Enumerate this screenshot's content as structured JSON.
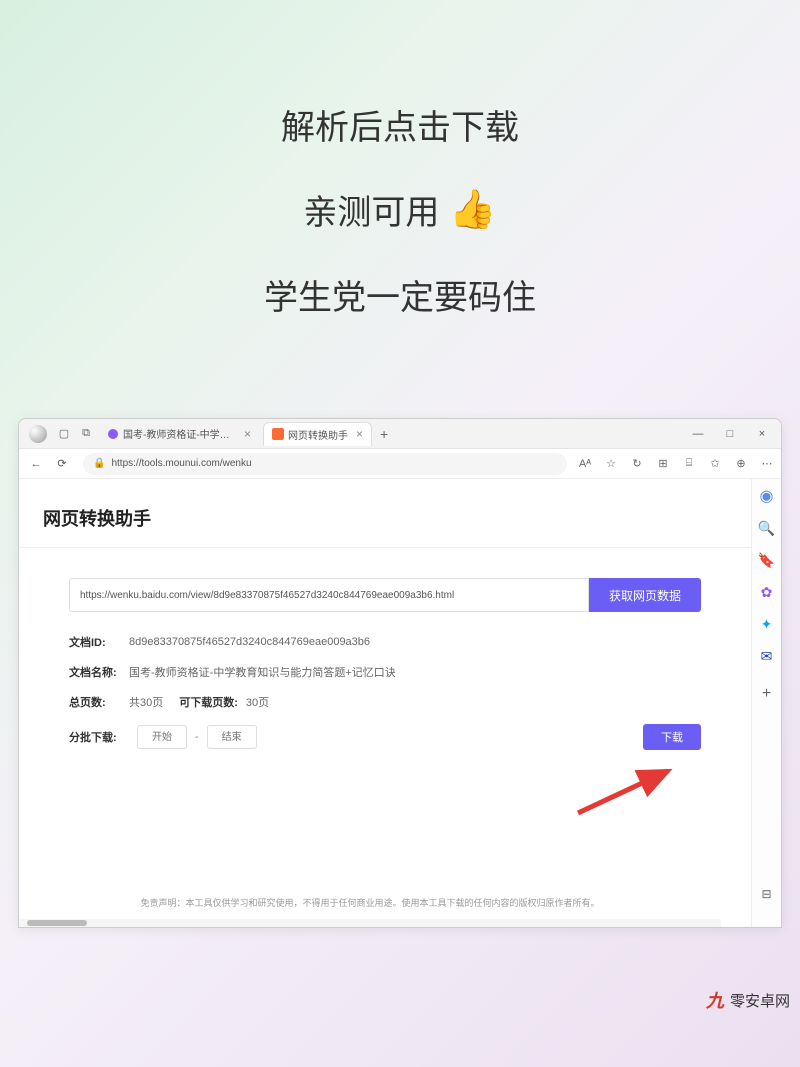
{
  "promo": {
    "line1": "解析后点击下载",
    "line2": "亲测可用",
    "line3": "学生党一定要码住"
  },
  "browser": {
    "tabs": [
      {
        "title": "国考-教师资格证-中学教育知识"
      },
      {
        "title": "网页转换助手"
      }
    ],
    "new_tab": "+",
    "window_controls": {
      "min": "—",
      "max": "□",
      "close": "×"
    },
    "nav": {
      "back": "←",
      "refresh": "⟳"
    },
    "url": "https://tools.mounui.com/wenku",
    "addr_tools": {
      "aa": "Aᴬ",
      "star": "☆",
      "refresh2": "↻",
      "puzzle": "⊞",
      "collections": "⌸",
      "favorites": "✩",
      "settings": "⊕",
      "more": "⋯"
    }
  },
  "sidebar_icons": [
    "◐",
    "🔍",
    "🔖",
    "✿",
    "✦",
    "✉"
  ],
  "page": {
    "title": "网页转换助手",
    "doc_url": "https://wenku.baidu.com/view/8d9e83370875f46527d3240c844769eae009a3b6.html",
    "fetch_button": "获取网页数据",
    "doc_id_label": "文档ID:",
    "doc_id": "8d9e83370875f46527d3240c844769eae009a3b6",
    "doc_name_label": "文档名称:",
    "doc_name": "国考-教师资格证-中学教育知识与能力简答题+记忆口诀",
    "total_pages_label": "总页数:",
    "total_pages": "共30页",
    "downloadable_label": "可下载页数:",
    "downloadable": "30页",
    "batch_label": "分批下载:",
    "start_placeholder": "开始",
    "end_placeholder": "结束",
    "download_button": "下载",
    "disclaimer": "免责声明：本工具仅供学习和研究使用，不得用于任何商业用途。使用本工具下载的任何内容的版权归原作者所有。"
  },
  "watermark": {
    "logo": "九",
    "text": "零安卓网"
  }
}
